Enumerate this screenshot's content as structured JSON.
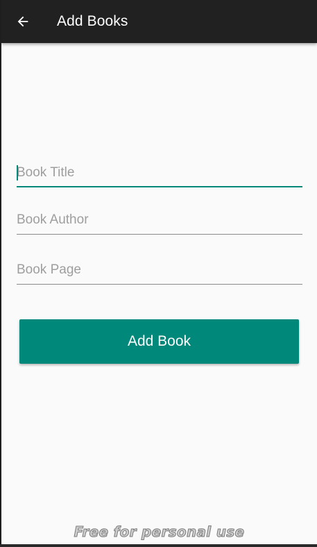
{
  "appbar": {
    "title": "Add Books",
    "back_icon": "arrow-back-icon",
    "background": "#212121"
  },
  "form": {
    "title_placeholder": "Book Title",
    "author_placeholder": "Book Author",
    "page_placeholder": "Book Page",
    "title_value": "",
    "author_value": "",
    "page_value": ""
  },
  "actions": {
    "add_label": "Add Book"
  },
  "colors": {
    "accent": "#00897b",
    "background": "#fafafa"
  },
  "watermark": "Free for personal use"
}
